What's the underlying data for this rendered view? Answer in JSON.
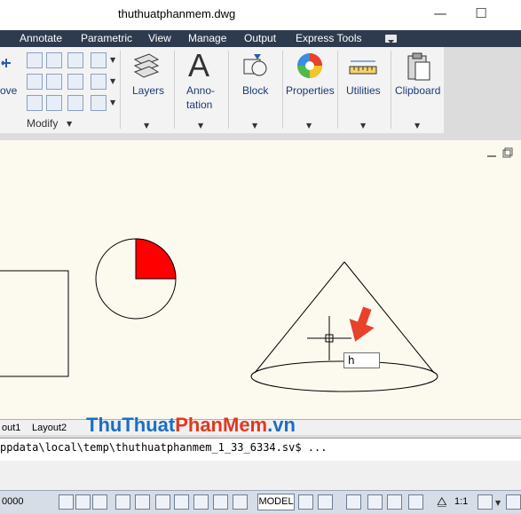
{
  "window": {
    "title": "thuthuatphanmem.dwg",
    "minimize_glyph": "—",
    "maximize_glyph": "☐"
  },
  "ribbon_tabs": [
    "Annotate",
    "Parametric",
    "View",
    "Manage",
    "Output",
    "Express Tools"
  ],
  "ribbon": {
    "move_label_fragment": "ove",
    "modify_panel_label": "Modify",
    "layers_label": "Layers",
    "annotation_label_line1": "Anno-",
    "annotation_label_line2": "tation",
    "annotation_glyph": "A",
    "block_label": "Block",
    "properties_label": "Properties",
    "utilities_label": "Utilities",
    "clipboard_label": "Clipboard"
  },
  "drawing": {
    "input_value": "h",
    "accent_color": "#ff0000"
  },
  "layout_tabs": [
    "out1",
    "Layout2"
  ],
  "watermark": {
    "part1": "ThuThuat",
    "part2": "PhanMem",
    "part3": ".vn"
  },
  "command_line": {
    "text": "ppdata\\local\\temp\\thuthuatphanmem_1_33_6334.sv$ ..."
  },
  "status_bar": {
    "coords": "0000",
    "model_label": "MODEL",
    "scale_label": "1:1"
  }
}
